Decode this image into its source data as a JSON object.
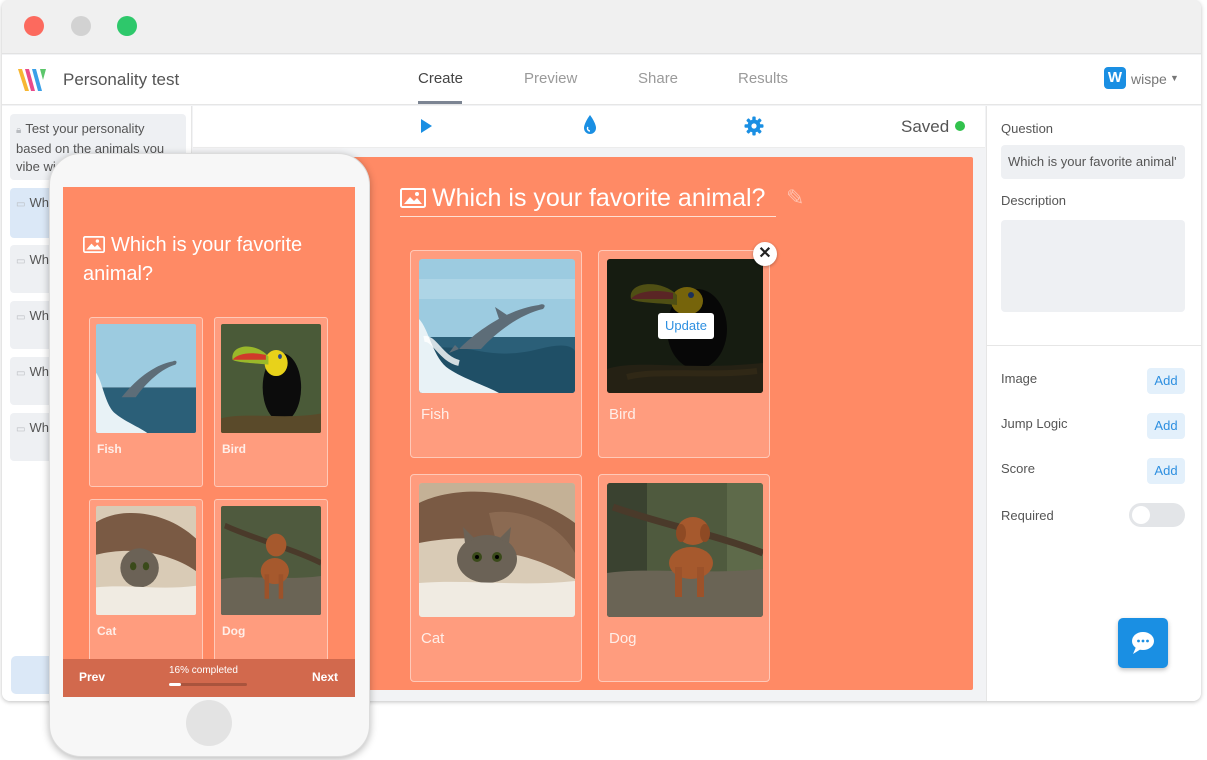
{
  "window": {
    "title": "Personality test"
  },
  "nav": {
    "tabs": [
      {
        "label": "Create",
        "active": true
      },
      {
        "label": "Preview",
        "active": false
      },
      {
        "label": "Share",
        "active": false
      },
      {
        "label": "Results",
        "active": false
      }
    ],
    "user_initial": "W",
    "user_name": "wispe"
  },
  "sidebar": {
    "items": [
      {
        "text": "Test your personality based on the animals you vibe wi",
        "active": false
      },
      {
        "text": "Wh anima",
        "active": true
      },
      {
        "text": "Wh cat?",
        "active": false
      },
      {
        "text": "Wh dog?",
        "active": false
      },
      {
        "text": "Wh fish?",
        "active": false
      },
      {
        "text": "Wh bird?",
        "active": false
      }
    ]
  },
  "toolbar": {
    "icons": [
      "play-icon",
      "drop-icon",
      "gear-icon"
    ],
    "status": "Saved",
    "status_color": "#32c24d"
  },
  "editor": {
    "question": "Which is your favorite animal?",
    "choices": [
      {
        "label": "Fish",
        "image": "dolphin-photo"
      },
      {
        "label": "Bird",
        "image": "toucan-photo"
      },
      {
        "label": "Cat",
        "image": "cat-photo"
      },
      {
        "label": "Dog",
        "image": "dog-photo"
      }
    ],
    "update_label": "Update",
    "accent": "#ff8a65"
  },
  "props": {
    "question_label": "Question",
    "question_value": "Which is your favorite animal'",
    "description_label": "Description",
    "image_label": "Image",
    "jump_logic_label": "Jump Logic",
    "score_label": "Score",
    "required_label": "Required",
    "add_label": "Add",
    "required_on": false
  },
  "phone": {
    "question": "Which is your favorite animal?",
    "choices": [
      "Fish",
      "Bird",
      "Cat",
      "Dog"
    ],
    "prev": "Prev",
    "next": "Next",
    "progress_text": "16% completed",
    "progress": 0.16
  }
}
